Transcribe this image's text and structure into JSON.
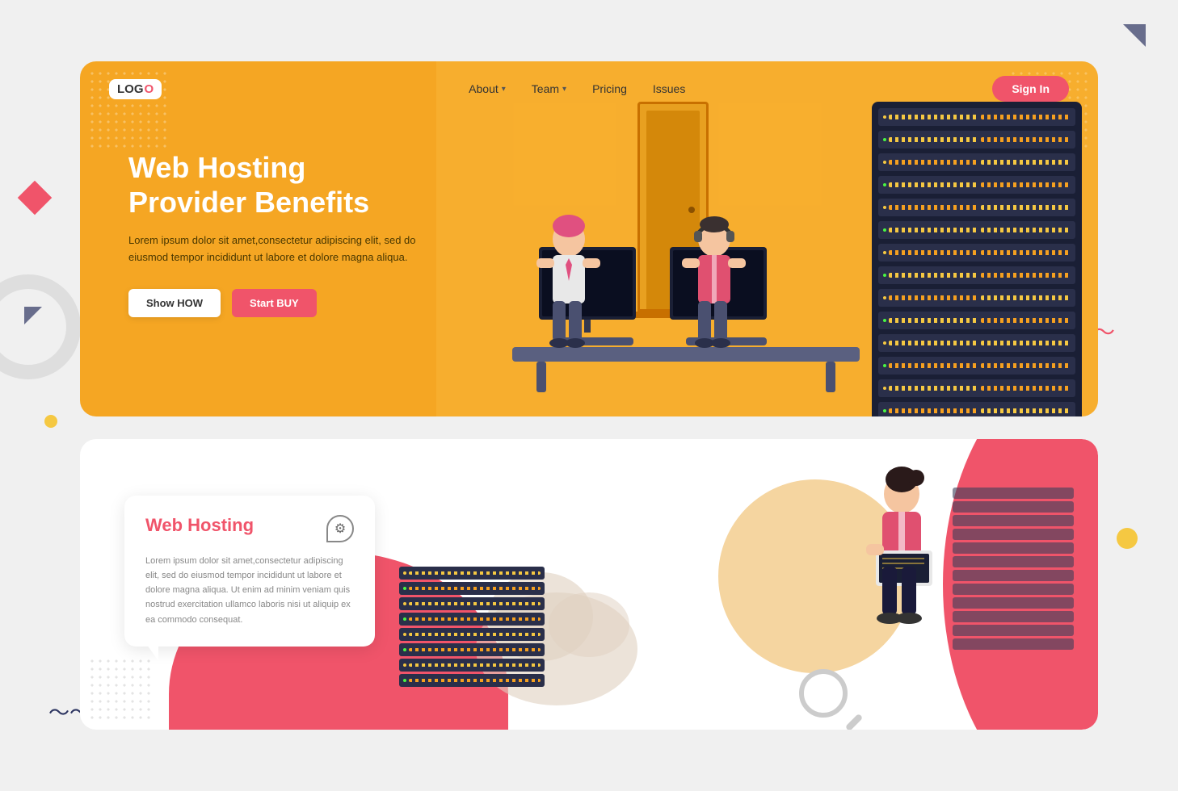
{
  "page": {
    "background": "#f0f0f0"
  },
  "section1": {
    "navbar": {
      "logo": "LOG",
      "logo_o": "O",
      "links": [
        {
          "label": "About",
          "has_dropdown": true
        },
        {
          "label": "Team",
          "has_dropdown": true
        },
        {
          "label": "Pricing",
          "has_dropdown": false
        },
        {
          "label": "Issues",
          "has_dropdown": false
        }
      ],
      "sign_in": "Sign In"
    },
    "hero": {
      "title_line1": "Web Hosting",
      "title_line2": "Provider Benefits",
      "description": "Lorem ipsum dolor sit amet,consectetur adipiscing elit, sed do eiusmod tempor incididunt ut labore et dolore magna aliqua.",
      "btn_show": "Show HOW",
      "btn_buy": "Start BUY"
    }
  },
  "section2": {
    "card": {
      "title": "Web Hosting",
      "description": "Lorem ipsum dolor sit amet,consectetur adipiscing elit, sed do eiusmod tempor incididunt ut labore et dolore magna aliqua. Ut enim ad minim veniam quis nostrud exercitation ullamco laboris nisi ut aliquip ex ea commodo consequat."
    }
  },
  "decorations": {
    "wave_symbol": "∿∿∿",
    "wave_bottom": "∿∿∿"
  }
}
